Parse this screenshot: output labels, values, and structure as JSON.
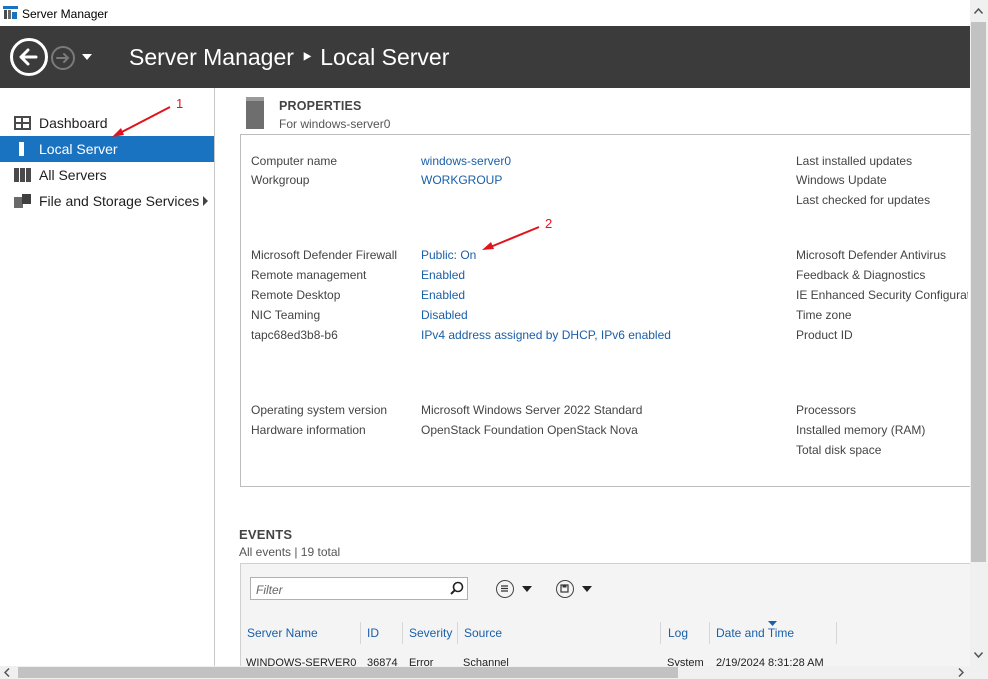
{
  "window": {
    "title": "Server Manager"
  },
  "header": {
    "title": "Server Manager ‣ Local Server"
  },
  "sidebar": {
    "items": [
      {
        "label": "Dashboard",
        "icon": "dashboard-icon"
      },
      {
        "label": "Local Server",
        "icon": "server-icon",
        "active": true
      },
      {
        "label": "All Servers",
        "icon": "servers-icon"
      },
      {
        "label": "File and Storage Services",
        "icon": "storage-icon"
      }
    ]
  },
  "properties": {
    "title": "PROPERTIES",
    "subtitle": "For windows-server0",
    "computer_name_label": "Computer name",
    "computer_name": "windows-server0",
    "workgroup_label": "Workgroup",
    "workgroup": "WORKGROUP",
    "firewall_label": "Microsoft Defender Firewall",
    "firewall": "Public: On",
    "remote_mgmt_label": "Remote management",
    "remote_mgmt": "Enabled",
    "remote_desktop_label": "Remote Desktop",
    "remote_desktop": "Enabled",
    "nic_teaming_label": "NIC Teaming",
    "nic_teaming": "Disabled",
    "adapter_label": "tapc68ed3b8-b6",
    "adapter": "IPv4 address assigned by DHCP, IPv6 enabled",
    "os_label": "Operating system version",
    "os": "Microsoft Windows Server 2022 Standard",
    "hw_label": "Hardware information",
    "hw": "OpenStack Foundation OpenStack Nova",
    "right": {
      "last_updates": "Last installed updates",
      "windows_update": "Windows Update",
      "last_checked": "Last checked for updates",
      "antivirus": "Microsoft Defender Antivirus",
      "feedback": "Feedback & Diagnostics",
      "ie_security": "IE Enhanced Security Configurati",
      "time_zone": "Time zone",
      "product_id": "Product ID",
      "processors": "Processors",
      "memory": "Installed memory (RAM)",
      "disk": "Total disk space"
    }
  },
  "events": {
    "title": "EVENTS",
    "subtitle": "All events | 19 total",
    "filter_placeholder": "Filter",
    "columns": [
      "Server Name",
      "ID",
      "Severity",
      "Source",
      "Log",
      "Date and Time"
    ],
    "first_row": [
      "WINDOWS-SERVER0",
      "36874",
      "Error",
      "Schannel",
      "System",
      "2/19/2024 8:31:28 AM"
    ]
  },
  "annotations": {
    "one": "1",
    "two": "2"
  },
  "colors": {
    "accent": "#1a73c0",
    "header_bg": "#3b3b3b",
    "link": "#1a5fa8",
    "annotation": "#e0141c"
  }
}
